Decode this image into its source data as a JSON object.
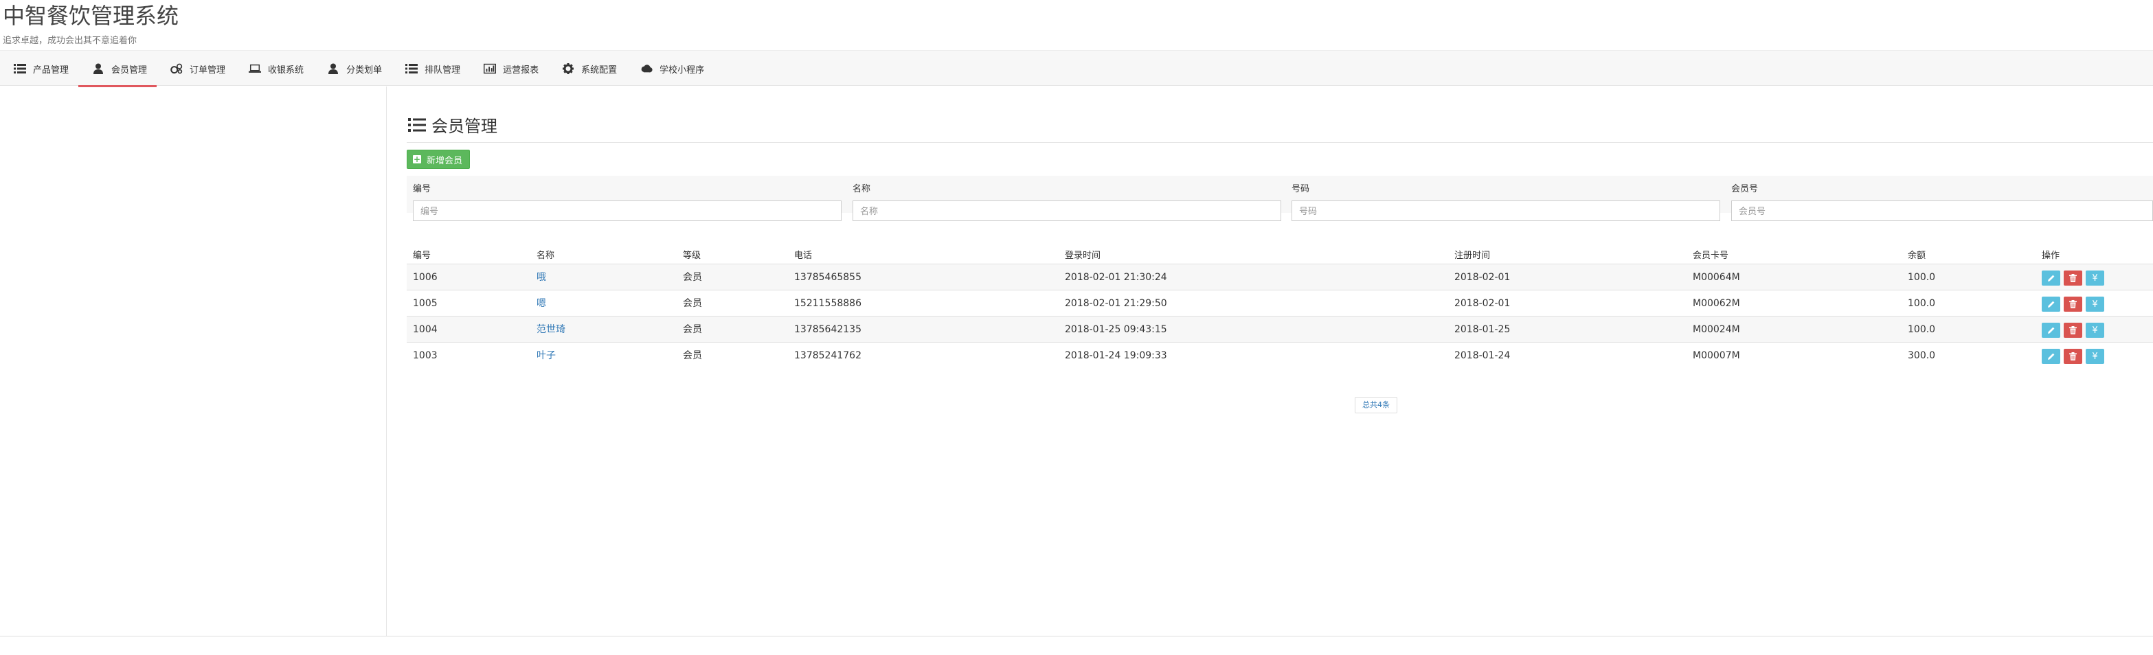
{
  "brand": {
    "title": "中智餐饮管理系统",
    "subtitle": "追求卓越，成功会出其不意追着你"
  },
  "nav": [
    {
      "label": "产品管理",
      "icon": "list-icon"
    },
    {
      "label": "会员管理",
      "icon": "user-icon",
      "active": true
    },
    {
      "label": "订单管理",
      "icon": "cogs-icon"
    },
    {
      "label": "收银系统",
      "icon": "laptop-icon"
    },
    {
      "label": "分类划单",
      "icon": "user-icon"
    },
    {
      "label": "排队管理",
      "icon": "list-icon"
    },
    {
      "label": "运营报表",
      "icon": "bar-chart-icon"
    },
    {
      "label": "系统配置",
      "icon": "gear-icon"
    },
    {
      "label": "学校小程序",
      "icon": "cloud-icon"
    }
  ],
  "page": {
    "title": "会员管理",
    "add_label": "新增会员"
  },
  "filters": [
    {
      "label": "编号",
      "placeholder": "编号"
    },
    {
      "label": "名称",
      "placeholder": "名称"
    },
    {
      "label": "号码",
      "placeholder": "号码"
    },
    {
      "label": "会员号",
      "placeholder": "会员号"
    }
  ],
  "table": {
    "headers": [
      "编号",
      "名称",
      "等级",
      "电话",
      "登录时间",
      "注册时间",
      "会员卡号",
      "余额",
      "操作"
    ],
    "rows": [
      [
        "1006",
        "哦",
        "会员",
        "13785465855",
        "2018-02-01 21:30:24",
        "2018-02-01",
        "M00064M",
        "100.0"
      ],
      [
        "1005",
        "嗯",
        "会员",
        "15211558886",
        "2018-02-01 21:29:50",
        "2018-02-01",
        "M00062M",
        "100.0"
      ],
      [
        "1004",
        "范世琦",
        "会员",
        "13785642135",
        "2018-01-25 09:43:15",
        "2018-01-25",
        "M00024M",
        "100.0"
      ],
      [
        "1003",
        "叶子",
        "会员",
        "13785241762",
        "2018-01-24 19:09:33",
        "2018-01-24",
        "M00007M",
        "300.0"
      ]
    ]
  },
  "pager": {
    "text": "总共4条"
  },
  "colors": {
    "accent": "#e0585e",
    "success": "#5cb85c",
    "info": "#5bc0de",
    "danger": "#d9534f",
    "link": "#337ab7"
  }
}
